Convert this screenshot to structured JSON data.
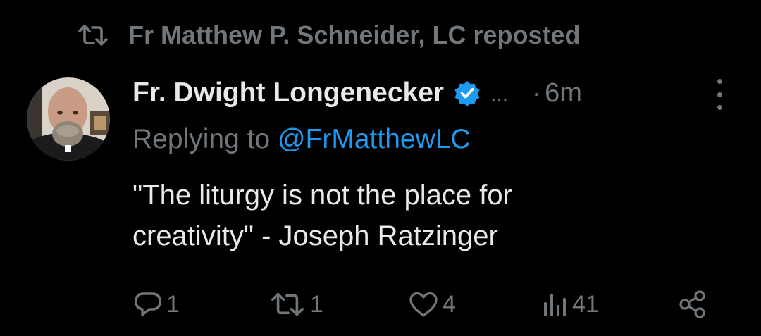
{
  "repost": {
    "icon": "repost-icon",
    "text": "Fr Matthew P. Schneider, LC reposted"
  },
  "author": {
    "name": "Fr. Dwight Longenecker",
    "verified_icon": "verified-badge-icon",
    "truncation": "...",
    "separator": "·",
    "time": "6m"
  },
  "reply": {
    "prefix": "Replying to",
    "handle": "@FrMatthewLC"
  },
  "tweet": {
    "lines": [
      "\"The liturgy is not the place for",
      "creativity\" - Joseph Ratzinger"
    ]
  },
  "actions": {
    "reply": {
      "icon": "reply-icon",
      "count": "1"
    },
    "repost": {
      "icon": "repost-icon",
      "count": "1"
    },
    "like": {
      "icon": "heart-icon",
      "count": "4"
    },
    "views": {
      "icon": "views-icon",
      "count": "41"
    },
    "share": {
      "icon": "share-icon"
    }
  },
  "colors": {
    "background": "#000000",
    "text_primary": "#e7e9ea",
    "text_secondary": "#71767b",
    "accent": "#1d9bf0"
  }
}
